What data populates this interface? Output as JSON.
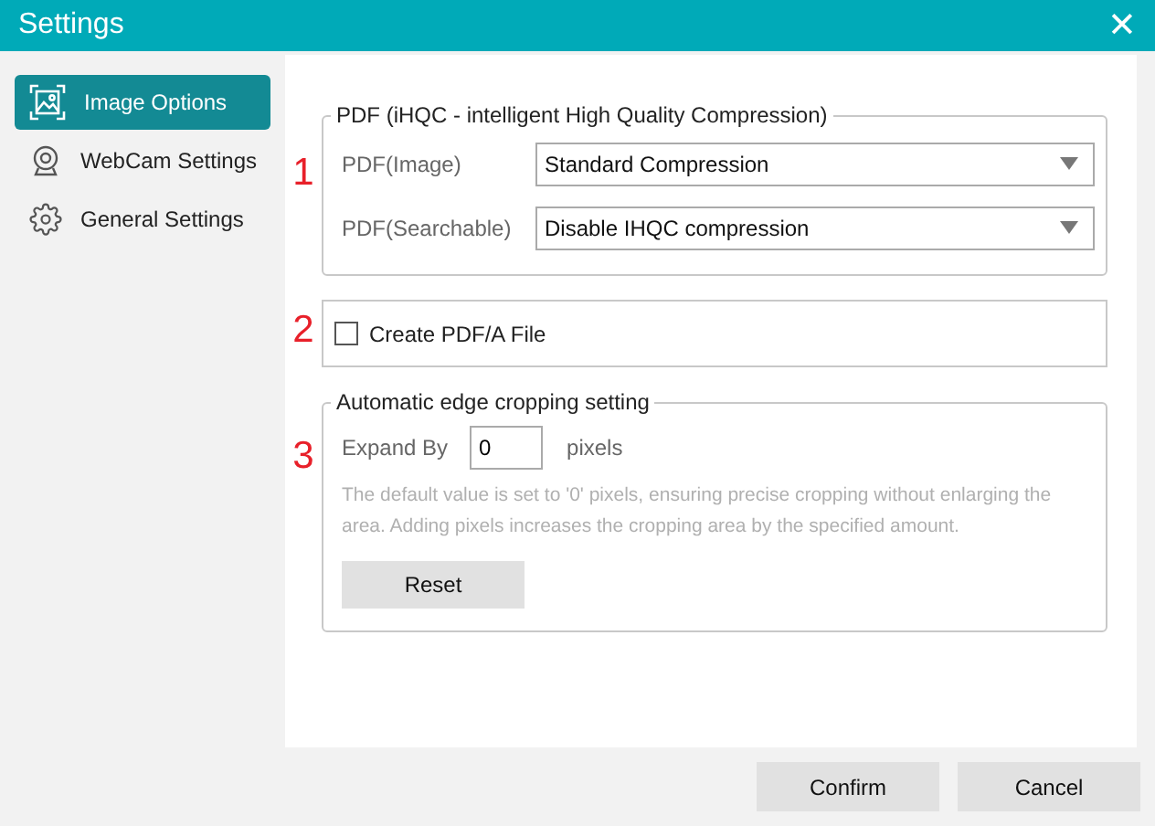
{
  "window": {
    "title": "Settings",
    "close": "✕"
  },
  "sidebar": {
    "items": [
      {
        "label": "Image Options",
        "selected": true
      },
      {
        "label": "WebCam Settings",
        "selected": false
      },
      {
        "label": "General Settings",
        "selected": false
      }
    ]
  },
  "pdf_group": {
    "marker": "1",
    "title": "PDF (iHQC - intelligent High Quality Compression)",
    "fields": [
      {
        "label": "PDF(Image)",
        "value": "Standard Compression"
      },
      {
        "label": "PDF(Searchable)",
        "value": "Disable IHQC compression"
      }
    ]
  },
  "pdfa": {
    "marker": "2",
    "label": "Create PDF/A File",
    "checked": false
  },
  "crop_group": {
    "marker": "3",
    "title": "Automatic edge cropping setting",
    "label": "Expand By",
    "value": "0",
    "unit": "pixels",
    "note": "The default value is set to '0' pixels, ensuring precise cropping without enlarging the area. Adding pixels increases the cropping area by the specified amount.",
    "reset": "Reset"
  },
  "buttons": [
    "Confirm",
    "Cancel"
  ]
}
